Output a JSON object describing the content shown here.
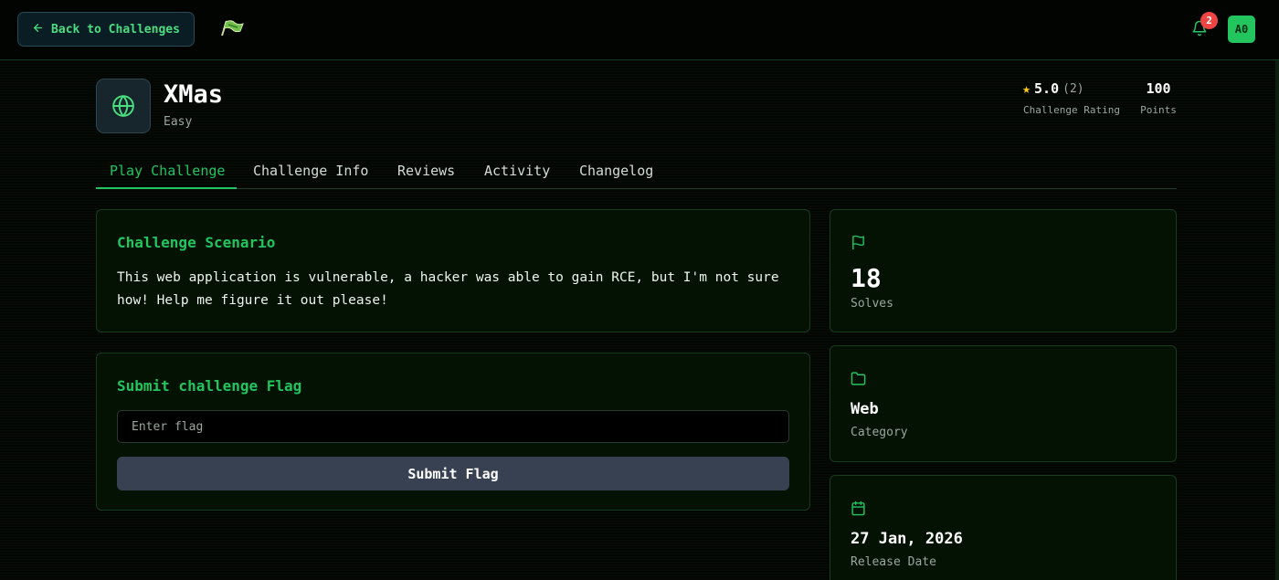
{
  "header": {
    "back_label": "Back to Challenges",
    "notification_count": "2",
    "avatar_initials": "A0"
  },
  "challenge": {
    "title": "XMas",
    "difficulty": "Easy",
    "rating_value": "5.0",
    "rating_count": "(2)",
    "rating_label": "Challenge Rating",
    "points_value": "100",
    "points_label": "Points"
  },
  "tabs": [
    {
      "label": "Play Challenge",
      "active": true
    },
    {
      "label": "Challenge Info",
      "active": false
    },
    {
      "label": "Reviews",
      "active": false
    },
    {
      "label": "Activity",
      "active": false
    },
    {
      "label": "Changelog",
      "active": false
    }
  ],
  "scenario": {
    "title": "Challenge Scenario",
    "text": "This web application is vulnerable, a hacker was able to gain RCE, but I'm not sure how! Help me figure it out please!"
  },
  "submit": {
    "title": "Submit challenge Flag",
    "placeholder": "Enter flag",
    "value": "",
    "button_label": "Submit Flag"
  },
  "stats": {
    "solves_value": "18",
    "solves_label": "Solves",
    "category_value": "Web",
    "category_label": "Category",
    "release_value": "27 Jan, 2026",
    "release_label": "Release Date"
  },
  "colors": {
    "accent": "#22c55e",
    "background": "#030603",
    "card": "#031203",
    "badge": "#ef4444",
    "star": "#facc15"
  }
}
